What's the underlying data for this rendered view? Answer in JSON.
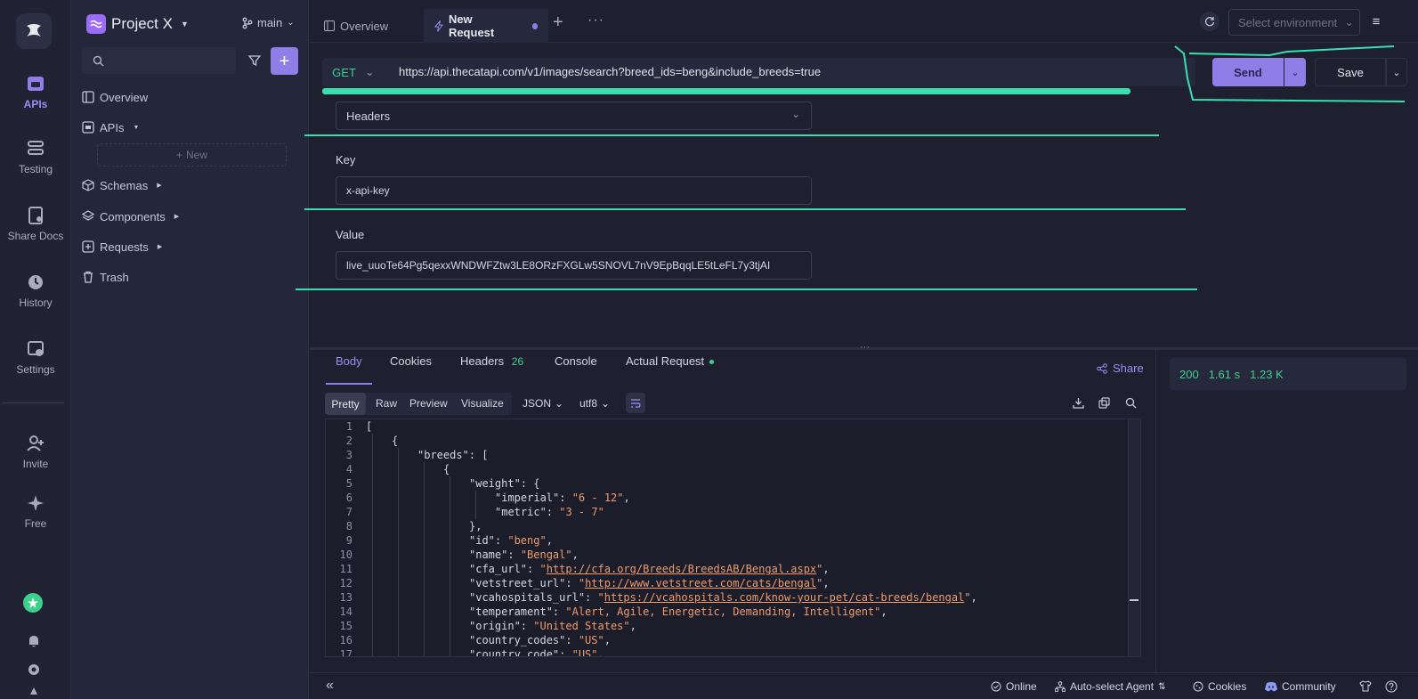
{
  "rail": {
    "items": [
      {
        "label": "APIs",
        "icon": "apis-icon"
      },
      {
        "label": "Testing",
        "icon": "testing-icon"
      },
      {
        "label": "Share Docs",
        "icon": "share-docs-icon"
      },
      {
        "label": "History",
        "icon": "history-icon"
      },
      {
        "label": "Settings",
        "icon": "settings-icon"
      },
      {
        "label": "Invite",
        "icon": "invite-icon"
      },
      {
        "label": "Free",
        "icon": "sparkle-icon"
      }
    ]
  },
  "sidebar": {
    "project_name": "Project X",
    "branch": "main",
    "search_placeholder": "",
    "new_label": "New",
    "items": [
      {
        "label": "Overview"
      },
      {
        "label": "APIs"
      },
      {
        "label": "Schemas"
      },
      {
        "label": "Components"
      },
      {
        "label": "Requests"
      },
      {
        "label": "Trash"
      }
    ]
  },
  "tabs": {
    "overview": "Overview",
    "new_request": "New Request"
  },
  "env": {
    "placeholder": "Select environment"
  },
  "request": {
    "method": "GET",
    "url": "https://api.thecatapi.com/v1/images/search?breed_ids=beng&include_breeds=true",
    "send_label": "Send",
    "save_label": "Save",
    "auth_type": "Headers",
    "key_label": "Key",
    "key_value": "x-api-key",
    "value_label": "Value",
    "value_value": "live_uuoTe64Pg5qexxWNDWFZtw3LE8ORzFXGLw5SNOVL7nV9EpBqqLE5tLeFL7y3tjAI"
  },
  "response": {
    "tabs": {
      "body": "Body",
      "cookies": "Cookies",
      "headers": "Headers",
      "headers_count": "26",
      "console": "Console",
      "actual": "Actual Request"
    },
    "share_label": "Share",
    "views": {
      "pretty": "Pretty",
      "raw": "Raw",
      "preview": "Preview",
      "visualize": "Visualize"
    },
    "format": "JSON",
    "encoding": "utf8",
    "status": "200",
    "time": "1.61 s",
    "size": "1.23 K",
    "code_lines": [
      "1",
      "2",
      "3",
      "4",
      "5",
      "6",
      "7",
      "8",
      "9",
      "10",
      "11",
      "12",
      "13",
      "14",
      "15",
      "16",
      "17"
    ]
  },
  "statusbar": {
    "online": "Online",
    "agent": "Auto-select Agent",
    "cookies": "Cookies",
    "community": "Community"
  },
  "colors": {
    "accent": "#8f7ee7",
    "success": "#3ecf8e",
    "string": "#f09a6a",
    "annotation": "#38e0b0"
  }
}
